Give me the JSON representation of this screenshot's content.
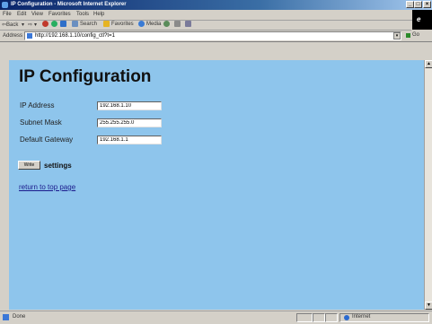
{
  "window": {
    "title": "IP Configuration - Microsoft Internet Explorer",
    "minimize": "_",
    "maximize": "□",
    "close": "×"
  },
  "menu": [
    "File",
    "Edit",
    "View",
    "Favorites",
    "Tools",
    "Help"
  ],
  "throbber": "e",
  "toolbar": {
    "back": "⇦Back",
    "back_drop": "▾",
    "forward": "⇨",
    "forward_drop": "▾",
    "search": "Search",
    "favorites": "Favorites",
    "media": "Media"
  },
  "address": {
    "label": "Address",
    "url": "http://192.168.1.10/config_ctl?t=1",
    "dropdown": "▾",
    "go": "Go"
  },
  "page": {
    "title": "IP Configuration",
    "fields": [
      {
        "label": "IP Address",
        "value": "192.168.1.10"
      },
      {
        "label": "Subnet Mask",
        "value": "255.255.255.0"
      },
      {
        "label": "Default Gateway",
        "value": "192.168.1.1"
      }
    ],
    "write_button": "Write",
    "settings_text": "settings",
    "link": "return to top page"
  },
  "scrollbar": {
    "up": "▲",
    "down": "▼"
  },
  "status": {
    "text": "Done",
    "zone": "Internet"
  },
  "colors": {
    "page_background": "#8ec5ec",
    "titlebar": "#0a246a",
    "link": "#1a1a8c"
  }
}
